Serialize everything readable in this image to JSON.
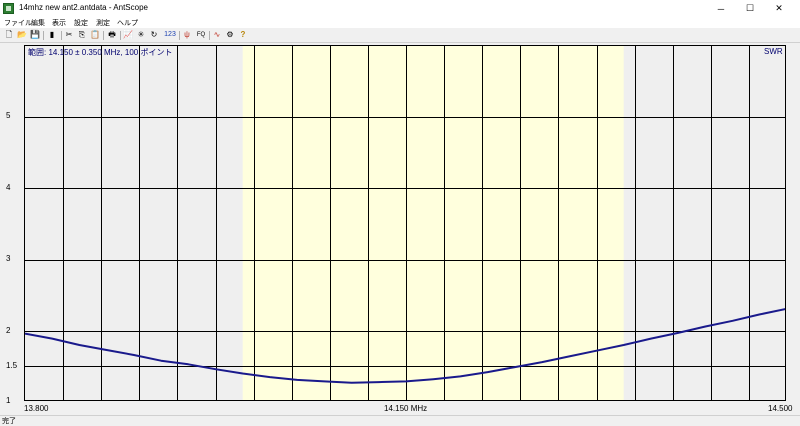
{
  "window": {
    "title": "14mhz new ant2.antdata - AntScope",
    "min": "─",
    "max": "☐",
    "close": "✕"
  },
  "menu": [
    "ファイル",
    "編集",
    "表示",
    "設定",
    "測定",
    "ヘルプ"
  ],
  "toolbar": [
    {
      "icon": "new-file-icon",
      "glyph": "🗋"
    },
    {
      "icon": "open-folder-icon",
      "glyph": "📂"
    },
    {
      "icon": "save-icon",
      "glyph": "💾"
    },
    {
      "icon": "device-icon",
      "glyph": "▮"
    },
    {
      "icon": "cut-icon",
      "glyph": "✂"
    },
    {
      "icon": "copy-icon",
      "glyph": "⎘"
    },
    {
      "icon": "paste-icon",
      "glyph": "📋"
    },
    {
      "icon": "print-icon",
      "glyph": "🖶"
    },
    {
      "icon": "graph-icon",
      "glyph": "📈"
    },
    {
      "icon": "scan-icon",
      "glyph": "✳"
    },
    {
      "icon": "refresh-icon",
      "glyph": "↻"
    },
    {
      "icon": "numbers-icon",
      "glyph": "123"
    },
    {
      "icon": "antenna-icon",
      "glyph": "ψ"
    },
    {
      "icon": "fq-icon",
      "glyph": "FQ"
    },
    {
      "icon": "wave-icon",
      "glyph": "∿"
    },
    {
      "icon": "calibrate-icon",
      "glyph": "⚙"
    },
    {
      "icon": "help-icon",
      "glyph": "?"
    }
  ],
  "plot": {
    "range_text": "範囲: 14.150 ± 0.350 MHz, 100 ポイント",
    "swr_label": "SWR"
  },
  "chart_data": {
    "type": "line",
    "x_min": 13.8,
    "x_max": 14.5,
    "ylim": [
      1,
      6
    ],
    "x_ticks": [
      "13.800",
      "14.150 MHz",
      "14.500"
    ],
    "y_ticks": [
      "5",
      "4",
      "3",
      "2",
      "1.5",
      "1"
    ],
    "band": [
      14.0,
      14.35
    ],
    "series": [
      {
        "points": [
          [
            13.8,
            1.96
          ],
          [
            13.825,
            1.89
          ],
          [
            13.85,
            1.8
          ],
          [
            13.875,
            1.73
          ],
          [
            13.9,
            1.66
          ],
          [
            13.925,
            1.58
          ],
          [
            13.95,
            1.53
          ],
          [
            13.975,
            1.46
          ],
          [
            14.0,
            1.4
          ],
          [
            14.025,
            1.35
          ],
          [
            14.05,
            1.31
          ],
          [
            14.075,
            1.29
          ],
          [
            14.1,
            1.27
          ],
          [
            14.125,
            1.28
          ],
          [
            14.15,
            1.29
          ],
          [
            14.175,
            1.32
          ],
          [
            14.2,
            1.36
          ],
          [
            14.225,
            1.42
          ],
          [
            14.25,
            1.49
          ],
          [
            14.275,
            1.56
          ],
          [
            14.3,
            1.64
          ],
          [
            14.325,
            1.72
          ],
          [
            14.35,
            1.8
          ],
          [
            14.375,
            1.89
          ],
          [
            14.4,
            1.97
          ],
          [
            14.425,
            2.06
          ],
          [
            14.45,
            2.14
          ],
          [
            14.475,
            2.23
          ],
          [
            14.5,
            2.31
          ]
        ]
      }
    ]
  },
  "status": "完了"
}
